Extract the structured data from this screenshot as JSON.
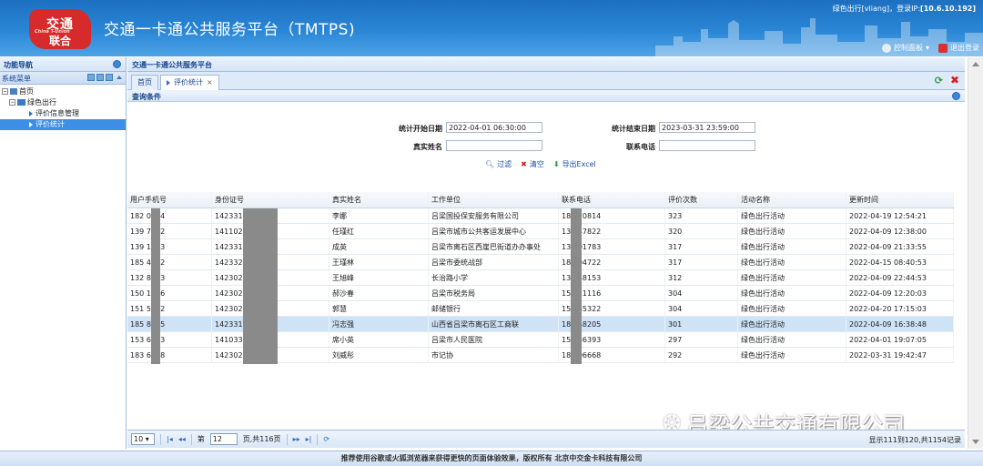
{
  "header": {
    "logo_line1": "交通",
    "logo_line2": "联合",
    "logo_sub": "China T-Union",
    "title": "交通一卡通公共服务平台（TMTPS)",
    "user_prefix": "绿色出行[vliang]，登录IP:",
    "user_ip": "[10.6.10.192]",
    "control_panel": "控制面板",
    "logout": "退出登录"
  },
  "left": {
    "nav_title": "功能导航",
    "menu_title": "系统菜单",
    "tree": [
      {
        "label": "首页",
        "level": 0
      },
      {
        "label": "绿色出行",
        "level": 1
      },
      {
        "label": "评价信息管理",
        "level": 2
      },
      {
        "label": "评价统计",
        "level": 2,
        "selected": true
      }
    ]
  },
  "breadcrumb": "交通一卡通公共服务平台",
  "tabs": {
    "home": "首页",
    "active": "评价统计",
    "close": "×"
  },
  "query": {
    "title": "查询条件",
    "start_label": "统计开始日期",
    "start_value": "2022-04-01 06:30:00",
    "end_label": "统计结束日期",
    "end_value": "2023-03-31 23:59:00",
    "name_label": "真实姓名",
    "name_value": "",
    "phone_label": "联系电话",
    "phone_value": "",
    "filter": "过滤",
    "clear": "清空",
    "export": "导出Excel"
  },
  "grid": {
    "columns": [
      "用户手机号",
      "身份证号",
      "真实姓名",
      "工作单位",
      "联系电话",
      "评价次数",
      "活动名称",
      "更新时间"
    ],
    "rows": [
      [
        "182     0814",
        "142331              0022",
        "李娜",
        "吕梁国投保安服务有限公司",
        "182     70814",
        "323",
        "绿色出行活动",
        "2022-04-19 12:54:21"
      ],
      [
        "139     7822",
        "141102              0025",
        "任瑾红",
        "吕梁市城市公共客运发展中心",
        "139     47822",
        "320",
        "绿色出行活动",
        "2022-04-09 12:38:00"
      ],
      [
        "139     1783",
        "142331              3725",
        "成英",
        "吕梁市离石区西崖巴街道办办事处",
        "139     01783",
        "317",
        "绿色出行活动",
        "2022-04-09 21:33:55"
      ],
      [
        "185     4722",
        "142332              0028",
        "王瑾林",
        "吕梁市委统战部",
        "185     04722",
        "317",
        "绿色出行活动",
        "2022-04-15 08:40:53"
      ],
      [
        "132     8153",
        "142302              0512",
        "王旭峰",
        "长治路小学",
        "132     48153",
        "312",
        "绿色出行活动",
        "2022-04-09 22:44:53"
      ],
      [
        "150     1116",
        "142302              0027",
        "郝沙春",
        "吕梁市税务局",
        "150     21116",
        "304",
        "绿色出行活动",
        "2022-04-09 12:20:03"
      ],
      [
        "151     5322",
        "142302              3725",
        "郭慧",
        "邮储银行",
        "151     35322",
        "304",
        "绿色出行活动",
        "2022-04-20 17:15:03"
      ],
      [
        "185     8205",
        "142331              0510",
        "冯志强",
        "山西省吕梁市离石区工商联",
        "185     48205",
        "301",
        "绿色出行活动",
        "2022-04-09 16:38:48"
      ],
      [
        "153     6393",
        "141033              0020",
        "席小英",
        "吕梁市人民医院",
        "153     36393",
        "297",
        "绿色出行活动",
        "2022-04-01 19:07:05"
      ],
      [
        "183     6668",
        "142302              0011",
        "刘威彤",
        "市记协",
        "183     06668",
        "292",
        "绿色出行活动",
        "2022-03-31 19:42:47"
      ]
    ],
    "highlight_row": 7
  },
  "pager": {
    "page_size": "10",
    "page_prefix": "第",
    "page_value": "12",
    "page_suffix": "页,共116页",
    "display": "显示111到120,共1154记录"
  },
  "watermark": "吕梁公共交通有限公司",
  "footer": "推荐使用谷歌或火狐浏览器来获得更快的页面体验效果，版权所有 北京中交金卡科技有限公司"
}
